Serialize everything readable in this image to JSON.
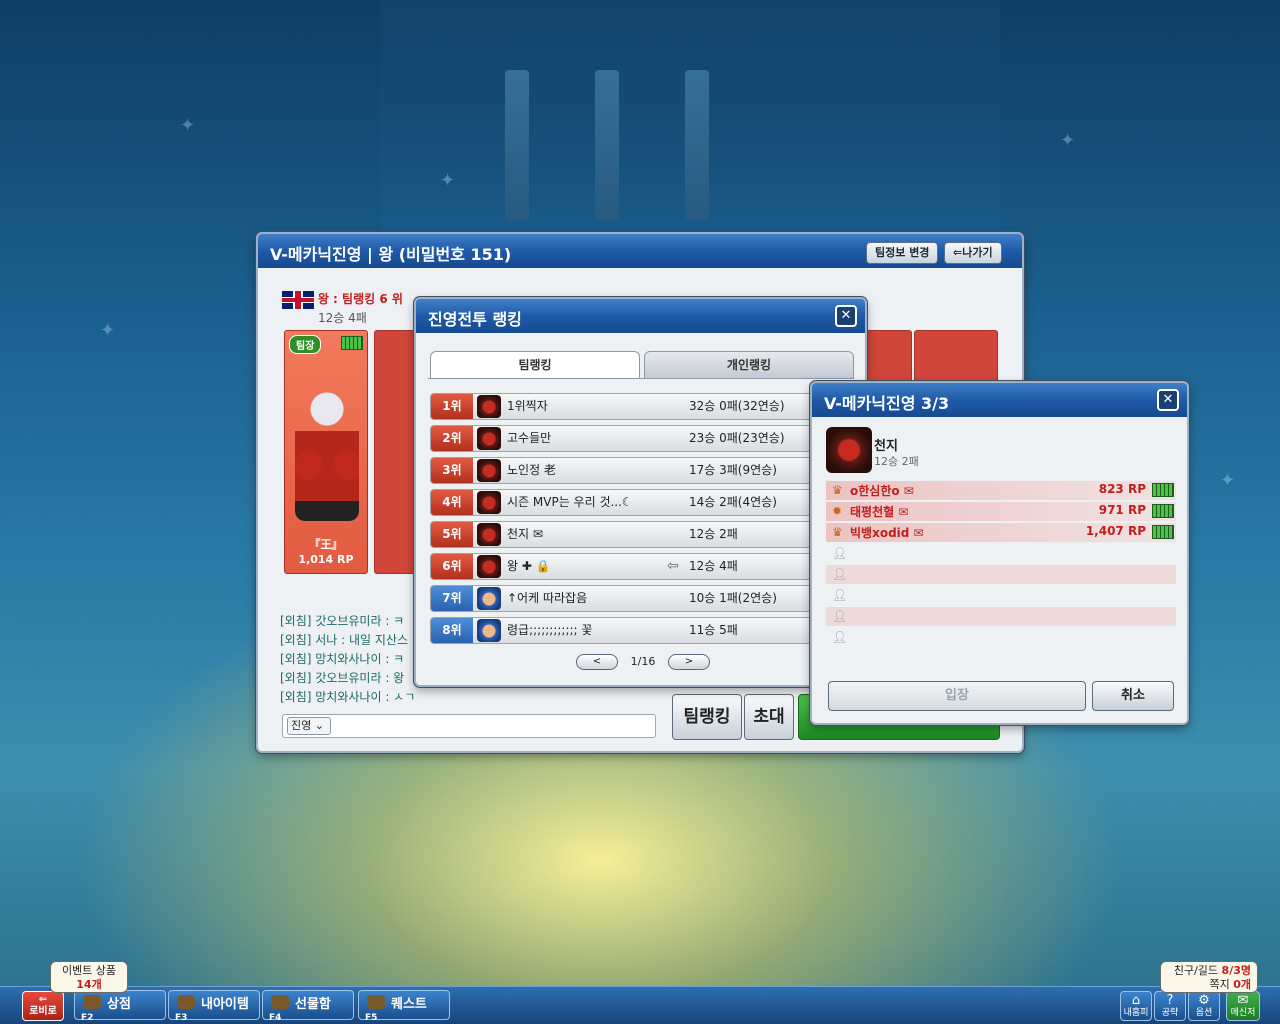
{
  "main_window": {
    "title": "V-메카닉진영 | 왕 (비밀번호 151)",
    "edit_team_button": "팀정보 변경",
    "exit_button": "⇐나가기",
    "team_rank": "왕 : 팀랭킹 6 위",
    "team_record": "12승 4패",
    "leader_badge": "팀장",
    "leader_name": "『王』",
    "leader_rp": "1,014 RP",
    "chat_lines": [
      "[외침] 갓오브유미라 : ㅋ ",
      "[외침] 서나 : 내일 지산스",
      "[외침] 망치와사나이 : ㅋ ",
      "[외침] 갓오브유미라 : 왕",
      "[외침] 망치와사나이 : ㅅㄱ"
    ],
    "chat_channel": "진영",
    "team_ranking_button": "팀랭킹",
    "invite_button": "초대"
  },
  "ranking_window": {
    "title": "진영전투 랭킹",
    "tabs": [
      "팀랭킹",
      "개인랭킹"
    ],
    "rows": [
      {
        "rank": "1위",
        "name": "1위찍자",
        "record": "32승 0패(32연승)",
        "color": "red"
      },
      {
        "rank": "2위",
        "name": "고수들만",
        "record": "23승 0패(23연승)",
        "color": "red"
      },
      {
        "rank": "3위",
        "name": "노인정 老",
        "record": "17승 3패(9연승)",
        "color": "red"
      },
      {
        "rank": "4위",
        "name": "시즌 MVP는 우리 것...☾",
        "record": "14승 2패(4연승)",
        "color": "red"
      },
      {
        "rank": "5위",
        "name": "천지 ✉",
        "record": "12승 2패",
        "color": "red"
      },
      {
        "rank": "6위",
        "name": "왕 ✚ 🔒",
        "record": "12승 4패",
        "color": "red"
      },
      {
        "rank": "7위",
        "name": "↑어케 따라잡음",
        "record": "10승 1패(2연승)",
        "color": "blue"
      },
      {
        "rank": "8위",
        "name": "령급;;;;;;;;;;;; 꽃",
        "record": "11승 5패",
        "color": "blue"
      }
    ],
    "page": "1/16"
  },
  "camp_window": {
    "title": "V-메카닉진영 3/3",
    "team_name": "천지",
    "team_record": "12승 2패",
    "members": [
      {
        "name": "o한심한o ✉",
        "rp": "823 RP"
      },
      {
        "name": "태평천혈 ✉",
        "rp": "971 RP"
      },
      {
        "name": "빅뱅xodid ✉",
        "rp": "1,407 RP"
      }
    ],
    "enter_button": "입장",
    "cancel_button": "취소"
  },
  "taskbar": {
    "lobby": "로비로",
    "event_label": "이벤트 상품",
    "event_count": "14개",
    "buttons": [
      {
        "fkey": "F2",
        "label": "상점"
      },
      {
        "fkey": "F3",
        "label": "내아이템"
      },
      {
        "fkey": "F4",
        "label": "선물함"
      },
      {
        "fkey": "F5",
        "label": "퀘스트"
      }
    ],
    "friend_label": "친구/길드",
    "friend_count": "8/3명",
    "note_label": "쪽지",
    "note_count": "0개",
    "sys_buttons": [
      "내홈피",
      "공략",
      "옵션",
      "메신저"
    ]
  },
  "colors": {
    "title_bar": "#1f5aa8",
    "rank_red": "#c0201e",
    "accent_green": "#4ec14a"
  }
}
